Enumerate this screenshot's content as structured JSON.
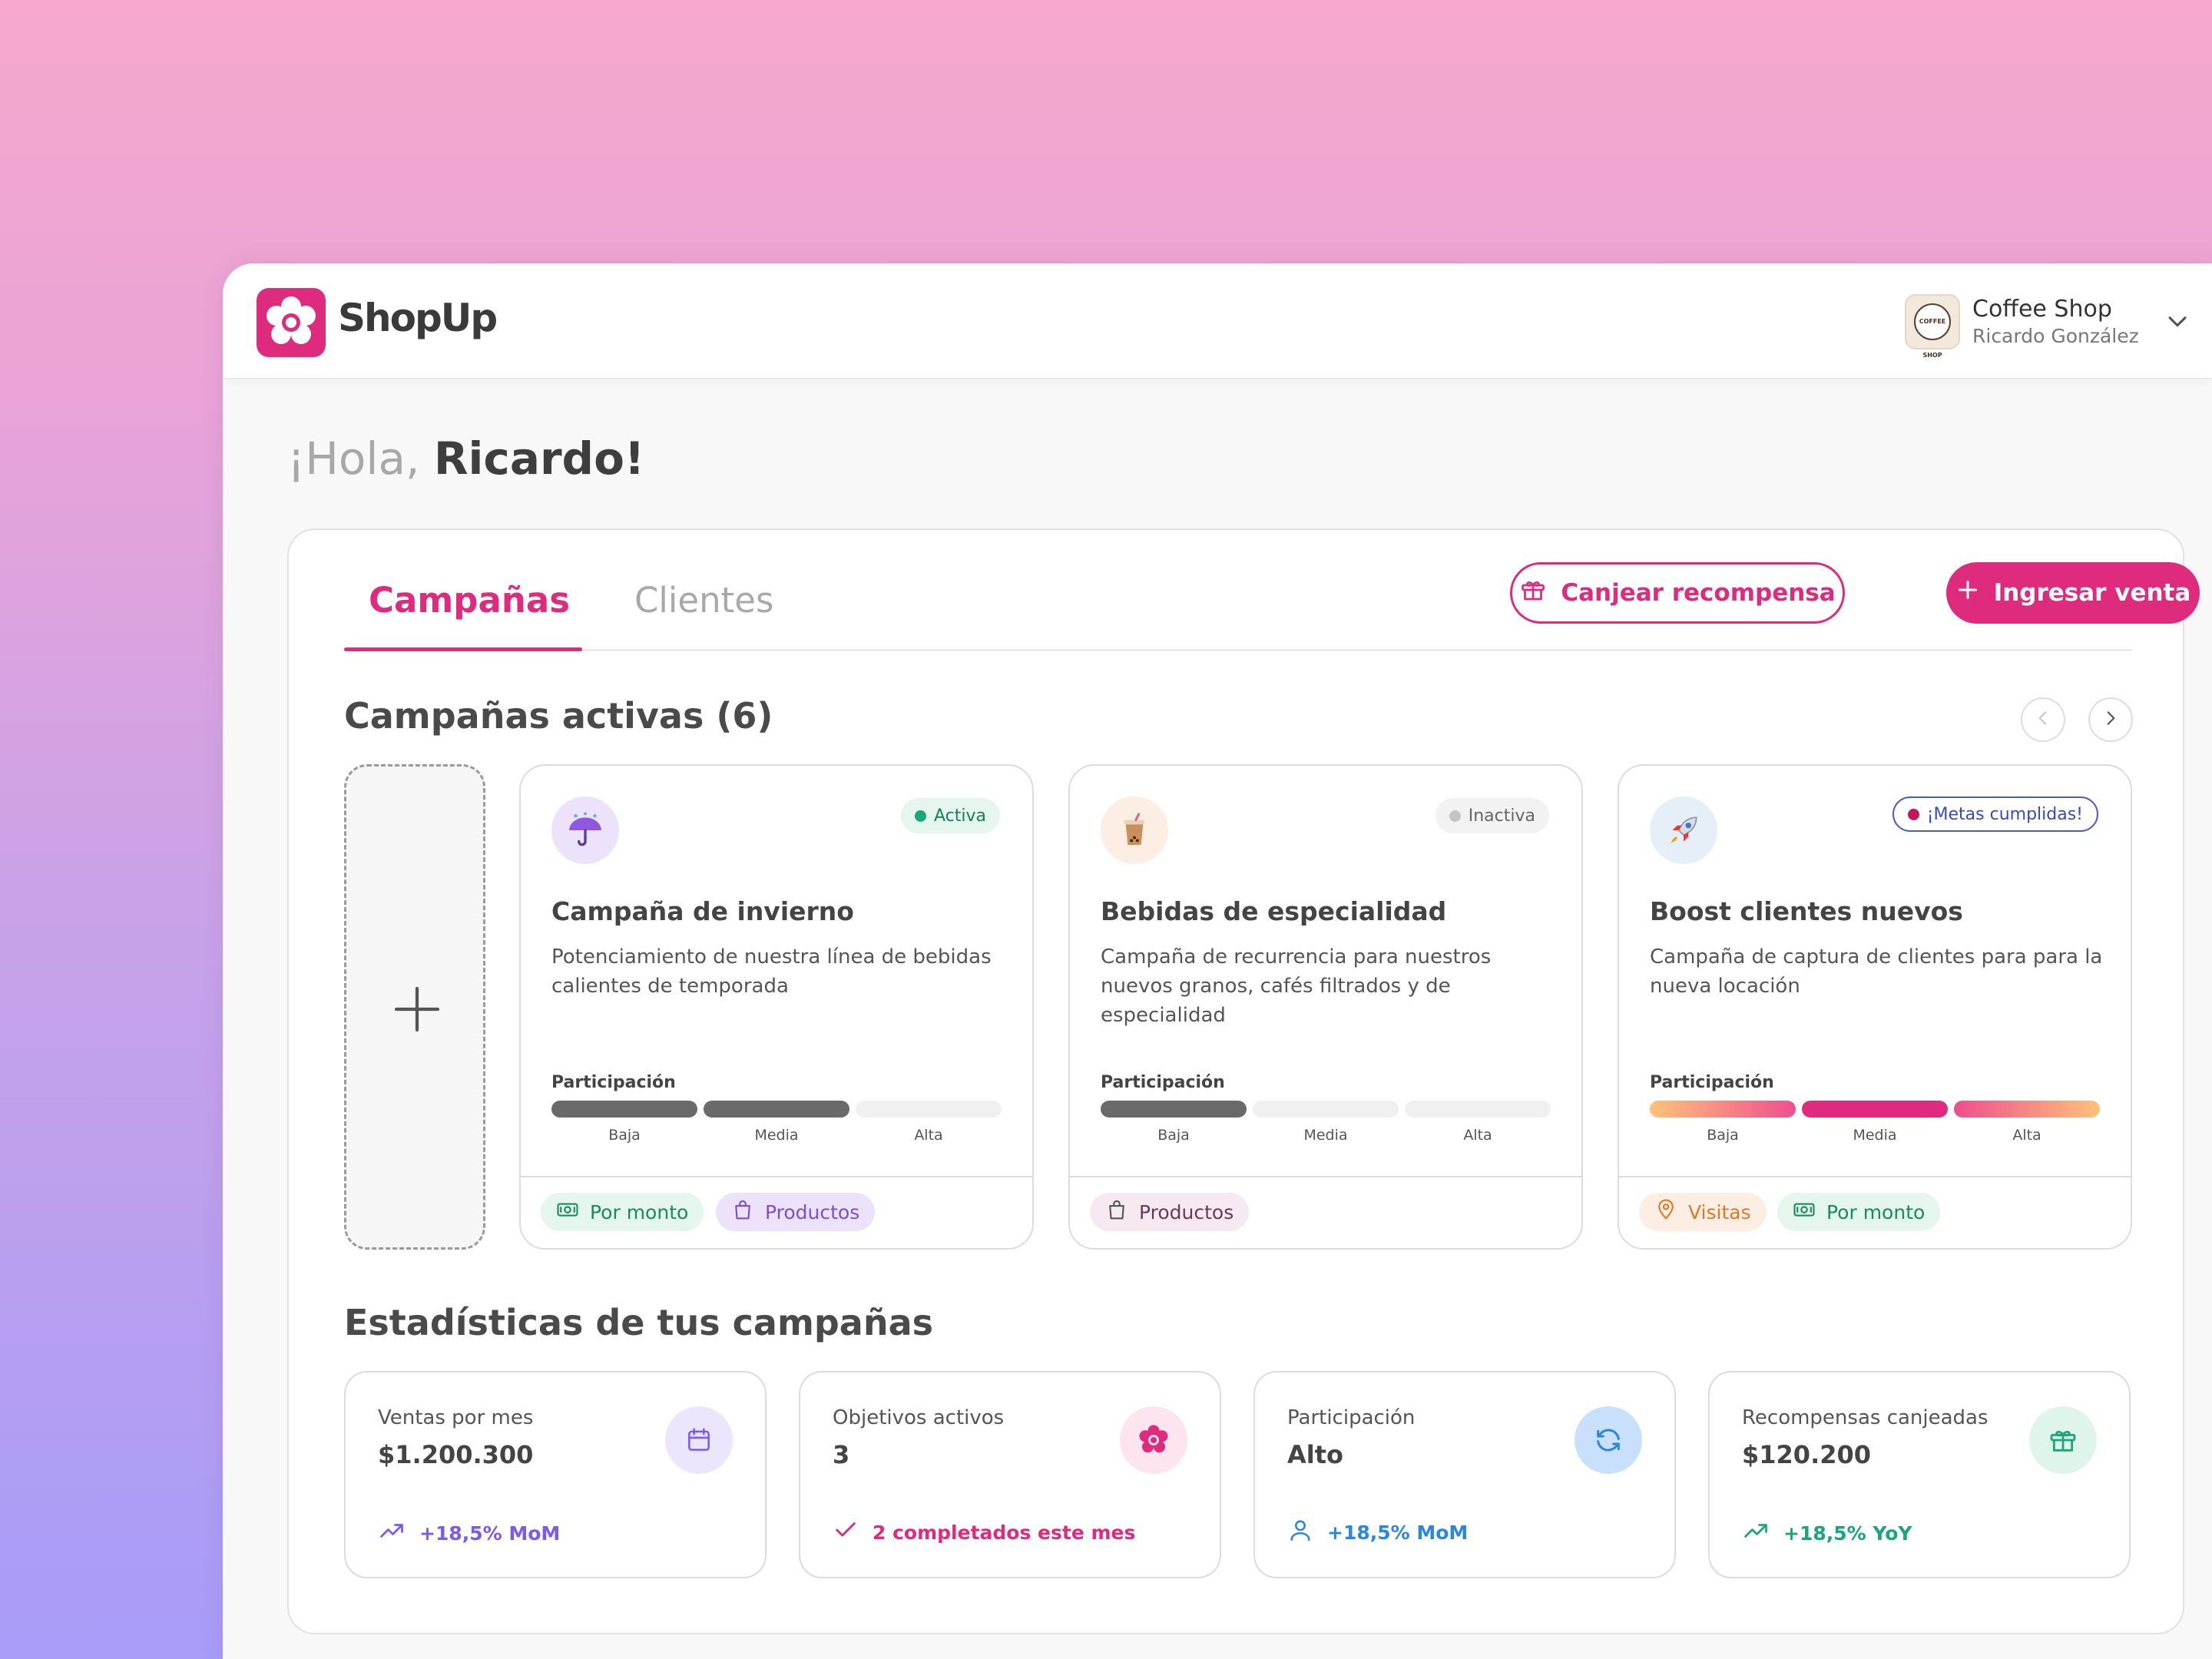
{
  "app": {
    "name": "ShopUp"
  },
  "account": {
    "shop_name": "Coffee Shop",
    "user_name": "Ricardo González",
    "avatar_text": "COFFEE SHOP"
  },
  "greeting": {
    "prefix": "¡Hola,",
    "name": "Ricardo!"
  },
  "tabs": [
    {
      "label": "Campañas",
      "active": true
    },
    {
      "label": "Clientes",
      "active": false
    }
  ],
  "actions": {
    "redeem_label": "Canjear recompensa",
    "add_sale_label": "Ingresar venta"
  },
  "active_campaigns": {
    "title": "Campañas activas (6)",
    "cards": [
      {
        "icon": "umbrella-icon",
        "status": "Activa",
        "status_color": "#1aa57a",
        "title": "Campaña de invierno",
        "description": "Potenciamiento de nuestra línea de bebidas calientes de temporada",
        "participation_label": "Participación",
        "participation_level": "Media",
        "levels": [
          "Baja",
          "Media",
          "Alta"
        ],
        "tags": [
          {
            "label": "Por monto",
            "icon": "money-icon"
          },
          {
            "label": "Productos",
            "icon": "bag-icon"
          }
        ]
      },
      {
        "icon": "bubble-tea-icon",
        "status": "Inactiva",
        "status_color": "#c4c4c4",
        "title": "Bebidas de especialidad",
        "description": "Campaña de recurrencia para nuestros nuevos granos, cafés filtrados y de especialidad",
        "participation_label": "Participación",
        "participation_level": "Baja",
        "levels": [
          "Baja",
          "Media",
          "Alta"
        ],
        "tags": [
          {
            "label": "Productos",
            "icon": "bag-icon"
          }
        ]
      },
      {
        "icon": "rocket-icon",
        "status": "¡Metas cumplidas!",
        "status_color": "#c2185b",
        "title": "Boost clientes nuevos",
        "description": "Campaña de captura de clientes para para la nueva locación",
        "participation_label": "Participación",
        "participation_level": "Alta",
        "levels": [
          "Baja",
          "Media",
          "Alta"
        ],
        "tags": [
          {
            "label": "Visitas",
            "icon": "location-icon"
          },
          {
            "label": "Por monto",
            "icon": "money-icon"
          }
        ]
      }
    ]
  },
  "stats": {
    "title": "Estadísticas de tus campañas",
    "cards": [
      {
        "label": "Ventas por mes",
        "value": "$1.200.300",
        "trend": "+18,5% MoM",
        "icon": "calendar-icon",
        "color": "#7a5af0"
      },
      {
        "label": "Objetivos activos",
        "value": "3",
        "trend": "2 completados este mes",
        "icon": "target-flower-icon",
        "color": "#de2b7d"
      },
      {
        "label": "Participación",
        "value": "Alto",
        "trend": "+18,5% MoM",
        "icon": "refresh-icon",
        "color": "#2b86e0"
      },
      {
        "label": "Recompensas canjeadas",
        "value": "$120.200",
        "trend": "+18,5% YoY",
        "icon": "gift-icon",
        "color": "#1aa57a"
      }
    ]
  }
}
